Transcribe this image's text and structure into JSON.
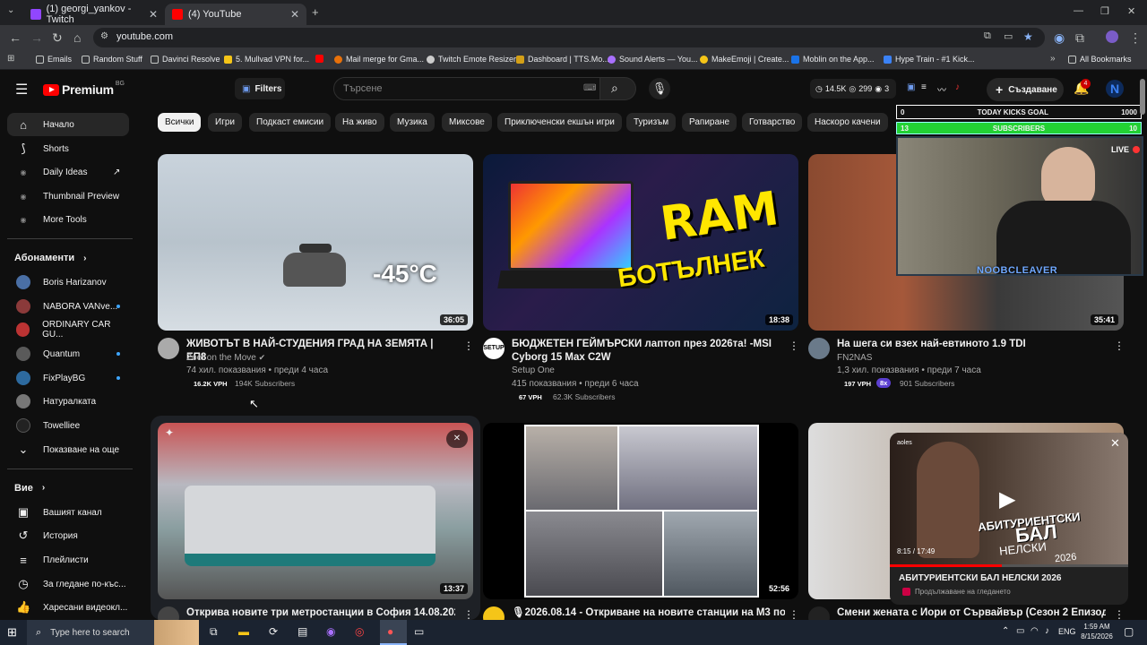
{
  "browser": {
    "tabs": [
      {
        "title": "(1) georgi_yankov - Twitch",
        "active": false,
        "favicon_color": "#9146ff"
      },
      {
        "title": "(4) YouTube",
        "active": true,
        "favicon_color": "#ff0000"
      }
    ],
    "url": "youtube.com",
    "bookmarks": [
      {
        "label": "Emails"
      },
      {
        "label": "Random Stuff"
      },
      {
        "label": "Davinci Resolve"
      },
      {
        "label": "5. Mullvad VPN for..."
      },
      {
        "label": "Mail merge for Gma..."
      },
      {
        "label": "Twitch Emote Resizer"
      },
      {
        "label": "Dashboard | TTS.Mo..."
      },
      {
        "label": "Sound Alerts — You..."
      },
      {
        "label": "MakeEmoji | Create..."
      },
      {
        "label": "Moblin on the App..."
      },
      {
        "label": "Hype Train - #1 Kick..."
      },
      {
        "label": "All Bookmarks"
      }
    ]
  },
  "youtube": {
    "logo_text": "Premium",
    "logo_region": "BG",
    "filters_label": "Filters",
    "search_placeholder": "Търсене",
    "stats": {
      "views": "14.5K",
      "likes": "299",
      "viewers": "3"
    },
    "create_label": "Създаване",
    "notifications_count": "4"
  },
  "sidebar": {
    "main": [
      {
        "label": "Начало",
        "icon": "home-icon",
        "active": true
      },
      {
        "label": "Shorts",
        "icon": "shorts-icon"
      },
      {
        "label": "Daily Ideas",
        "icon": "ext-icon"
      },
      {
        "label": "Thumbnail Preview",
        "icon": "ext-icon"
      },
      {
        "label": "More Tools",
        "icon": "ext-icon"
      }
    ],
    "subscriptions_header": "Абонаменти",
    "subscriptions": [
      {
        "label": "Boris Harizanov",
        "dot": false,
        "color": "#4a6fa5"
      },
      {
        "label": "NABORA VANve...",
        "dot": true,
        "color": "#8b3a3a"
      },
      {
        "label": "ORDINARY CAR GU...",
        "dot": false,
        "color": "#b33"
      },
      {
        "label": "Quantum",
        "dot": true,
        "color": "#5a5a5a"
      },
      {
        "label": "FixPlayBG",
        "dot": true,
        "color": "#2d6a9f"
      },
      {
        "label": "Натуралката",
        "dot": false,
        "color": "#777"
      },
      {
        "label": "Towelliee",
        "dot": false,
        "color": "#222"
      }
    ],
    "show_more": "Показване на още",
    "you_header": "Вие",
    "you": [
      {
        "label": "Вашият канал",
        "icon": "channel-icon"
      },
      {
        "label": "История",
        "icon": "history-icon"
      },
      {
        "label": "Плейлисти",
        "icon": "playlist-icon"
      },
      {
        "label": "За гледане по-къс...",
        "icon": "watch-later-icon"
      },
      {
        "label": "Харесани видеокл...",
        "icon": "like-icon"
      }
    ]
  },
  "chips": [
    "Всички",
    "Игри",
    "Подкаст емисии",
    "На живо",
    "Музика",
    "Миксове",
    "Приключенски екшън игри",
    "Туризъм",
    "Рапиране",
    "Готварство",
    "Наскоро качени"
  ],
  "videos": [
    {
      "title": "ЖИВОТЪТ В НАЙ-СТУДЕНИЯ ГРАД НА ЗЕМЯТА | ЕП8",
      "channel": "Zoef on the Move",
      "verified": true,
      "meta": "74 хил. показвания • преди 4 часа",
      "vph": "16.2K VPH",
      "subs": "194K Subscribers",
      "duration": "36:05",
      "thumb_text": "-45°C"
    },
    {
      "title": "БЮДЖЕТЕН ГЕЙМЪРСКИ лаптоп през 2026та! -MSI Cyborg 15 Max C2W",
      "channel": "Setup One",
      "verified": false,
      "meta": "415 показвания • преди 6 часа",
      "vph": "67 VPH",
      "subs": "62.3K Subscribers",
      "duration": "18:38",
      "thumb_text": "RAM",
      "thumb_text2": "БОТЪЛНЕК"
    },
    {
      "title": "На шега си взех най-евтиното 1.9 TDI",
      "channel": "FN2NAS",
      "verified": false,
      "meta": "1,3 хил. показвания • преди 7 часа",
      "vph": "197 VPH",
      "vph_x": "8x",
      "subs": "901 Subscribers",
      "duration": "35:41"
    },
    {
      "title": "Открива новите три метростанции в София 14.08.2026",
      "duration": "13:37"
    },
    {
      "title": "🎙2026.08.14 - Откриване на новите станции на М3 под бул.",
      "duration": "52:56"
    },
    {
      "title": "Смени жената с Иори от Сървайвър (Сезон 2 Епизод 14 -",
      "duration": ""
    }
  ],
  "overlay": {
    "goal_label": "TODAY KICKS GOAL",
    "goal_min": "0",
    "goal_max": "1000",
    "subs_label": "SUBSCRIBERS",
    "subs_min": "13",
    "subs_max": "10",
    "live_label": "LIVE",
    "streamer_name": "NOOBCLEAVER"
  },
  "miniplayer": {
    "channel": "aoles",
    "title": "АБИТУРИЕНТСКИ БАЛ НЕЛСКИ 2026",
    "time": "8:15 / 17:49",
    "resume": "Продължаване на гледането",
    "thumb_line1": "АБИТУРИЕНТСКИ",
    "thumb_line2": "БАЛ",
    "thumb_line3": "НЕЛСКИ",
    "thumb_line4": "2026"
  },
  "taskbar": {
    "search_placeholder": "Type here to search",
    "language": "ENG",
    "time": "1:59 AM",
    "date": "8/15/2026"
  }
}
